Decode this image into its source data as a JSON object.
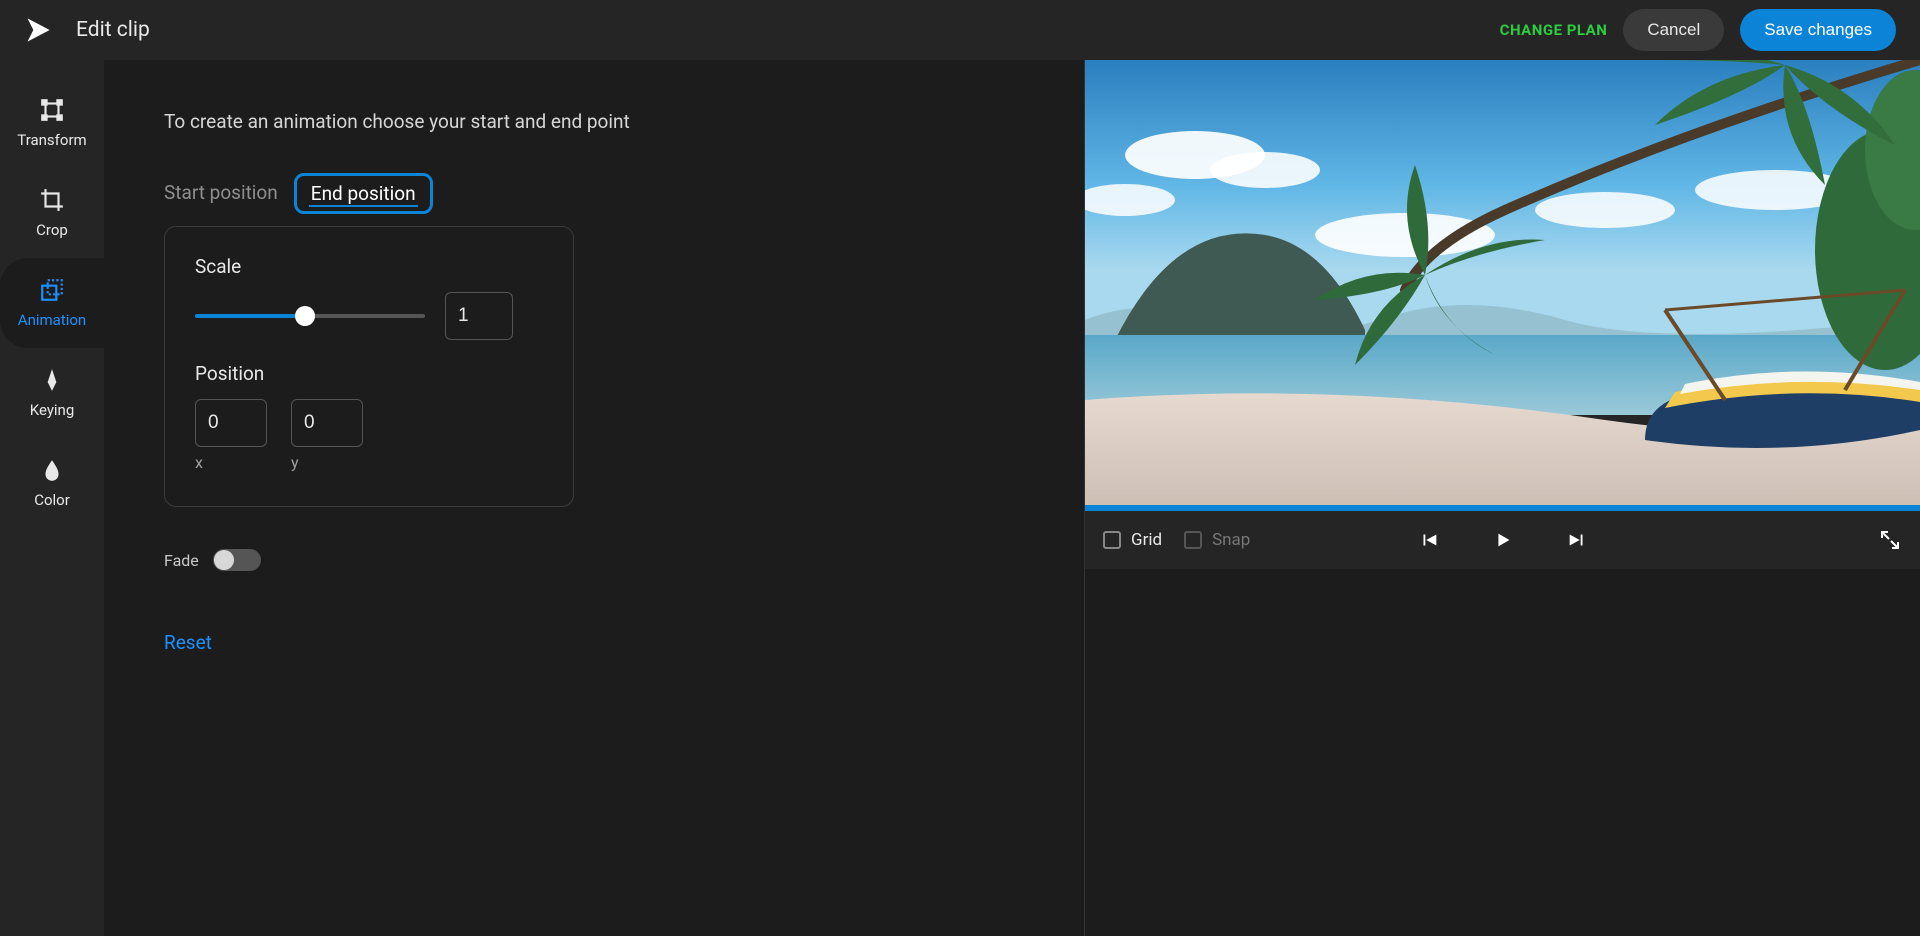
{
  "header": {
    "title": "Edit clip",
    "change_plan": "CHANGE PLAN",
    "cancel": "Cancel",
    "save": "Save changes"
  },
  "sidebar": {
    "items": [
      {
        "label": "Transform",
        "icon": "transform-icon"
      },
      {
        "label": "Crop",
        "icon": "crop-icon"
      },
      {
        "label": "Animation",
        "icon": "animation-icon"
      },
      {
        "label": "Keying",
        "icon": "keying-icon"
      },
      {
        "label": "Color",
        "icon": "color-icon"
      }
    ],
    "active_index": 2
  },
  "panel": {
    "intro": "To create an animation choose your start and end point",
    "tabs": {
      "start": "Start position",
      "end": "End position",
      "active": "end"
    },
    "scale": {
      "label": "Scale",
      "value": "1",
      "fraction": 0.48
    },
    "position": {
      "label": "Position",
      "x": "0",
      "y": "0",
      "x_label": "x",
      "y_label": "y"
    },
    "fade": {
      "label": "Fade",
      "on": false
    },
    "reset": "Reset"
  },
  "preview": {
    "grid": "Grid",
    "snap": "Snap"
  }
}
